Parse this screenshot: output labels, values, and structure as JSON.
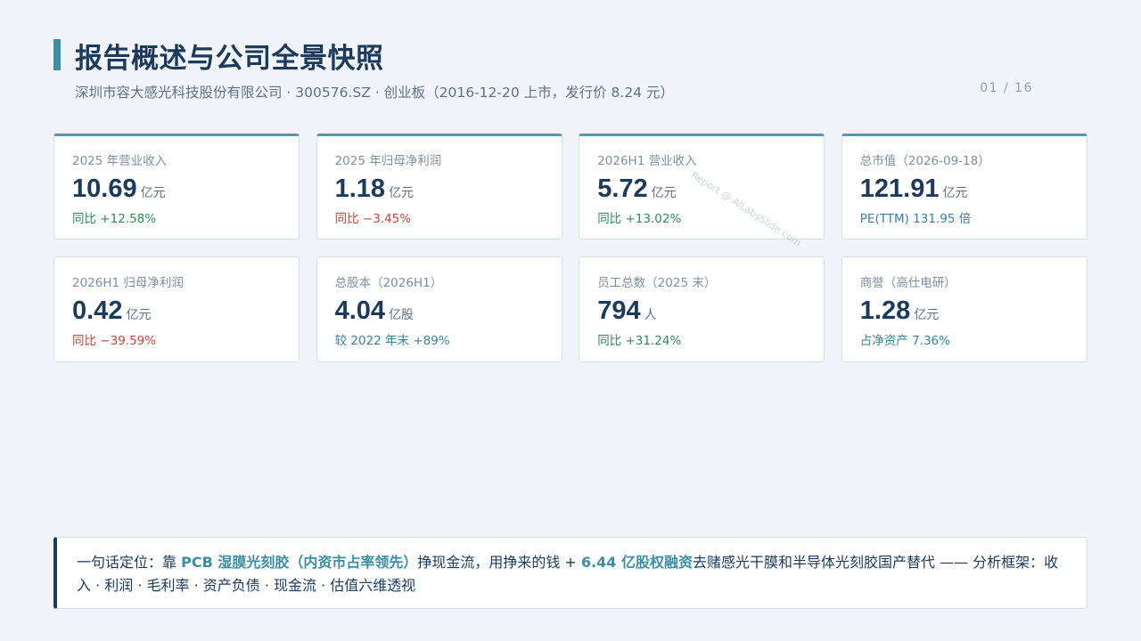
{
  "header": {
    "title": "报告概述与公司全景快照",
    "subtitle": "深圳市容大感光科技股份有限公司 · 300576.SZ · 创业板（2016-12-20 上市，发行价 8.24 元）",
    "page_number": "01 / 16"
  },
  "watermark": "Report @ AlLabsSlide.com",
  "cards": [
    {
      "label": "2025 年营业收入",
      "value": "10.69",
      "unit": "亿元",
      "note": "同比 +12.58%"
    },
    {
      "label": "2025 年归母净利润",
      "value": "1.18",
      "unit": "亿元",
      "note": "同比 −3.45%"
    },
    {
      "label": "2026H1 营业收入",
      "value": "5.72",
      "unit": "亿元",
      "note": "同比 +13.02%"
    },
    {
      "label": "总市值（2026-09-18）",
      "value": "121.91",
      "unit": "亿元",
      "note": "PE(TTM) 131.95 倍"
    },
    {
      "label": "2026H1 归母净利润",
      "value": "0.42",
      "unit": "亿元",
      "note": "同比 −39.59%"
    },
    {
      "label": "总股本（2026H1）",
      "value": "4.04",
      "unit": "亿股",
      "note": "较 2022 年末 +89%"
    },
    {
      "label": "员工总数（2025 末）",
      "value": "794",
      "unit": "人",
      "note": "同比 +31.24%"
    },
    {
      "label": "商誉（高仕电研）",
      "value": "1.28",
      "unit": "亿元",
      "note": "占净资产 7.36%"
    }
  ],
  "summary": {
    "prefix": "一句话定位：靠 ",
    "highlight1": "PCB 湿膜光刻胶（内资市占率领先）",
    "mid1": "挣现金流，用挣来的钱 + ",
    "highlight2": "6.44 亿股权融资",
    "suffix": "去赌感光干膜和半导体光刻胶国产替代 —— 分析框架：收入 · 利润 · 毛利率 · 资产负债 · 现金流 · 估值六维透视"
  }
}
